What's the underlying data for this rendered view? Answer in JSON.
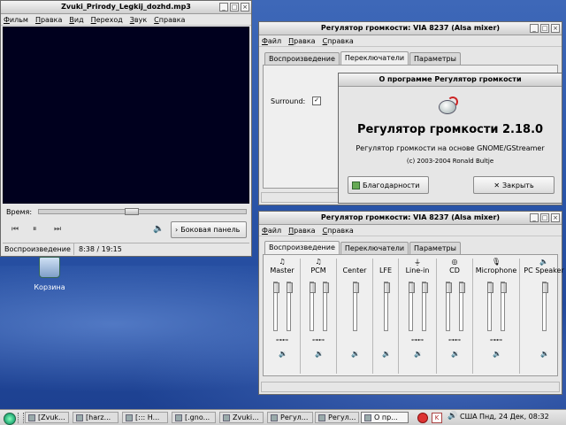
{
  "desktop": {
    "trash_label": "Корзина"
  },
  "player": {
    "title": "Zvuki_Prirody_Legkij_dozhd.mp3",
    "menu": [
      "Фильм",
      "Правка",
      "Вид",
      "Переход",
      "Звук",
      "Справка"
    ],
    "time_label": "Время:",
    "sidebar_button": "Боковая панель",
    "status_state": "Воспроизведение",
    "status_time": "8:38 / 19:15",
    "seek_progress": 0.44
  },
  "mixer_top": {
    "title": "Регулятор громкости: VIA 8237 (Alsa mixer)",
    "menu": [
      "Файл",
      "Правка",
      "Справка"
    ],
    "tabs": [
      "Воспроизведение",
      "Переключатели",
      "Параметры"
    ],
    "active_tab": 1,
    "surround_label": "Surround:",
    "surround_checked": true
  },
  "about": {
    "title": "О программе Регулятор громкости",
    "app_name": "Регулятор громкости 2.18.0",
    "description": "Регулятор громкости на основе GNOME/GStreamer",
    "copyright": "(c) 2003-2004 Ronald Bultje",
    "credits_button": "Благодарности",
    "close_button": "Закрыть"
  },
  "mixer_bottom": {
    "title": "Регулятор громкости: VIA 8237 (Alsa mixer)",
    "menu": [
      "Файл",
      "Правка",
      "Справка"
    ],
    "tabs": [
      "Воспроизведение",
      "Переключатели",
      "Параметры"
    ],
    "active_tab": 0,
    "channels": [
      {
        "name": "Master",
        "icon": "note-icon",
        "stereo": true,
        "levels": [
          0.0,
          0.0
        ]
      },
      {
        "name": "PCM",
        "icon": "note-icon",
        "stereo": true,
        "levels": [
          0.0,
          0.0
        ]
      },
      {
        "name": "Center",
        "icon": "",
        "stereo": false,
        "levels": [
          0.0
        ]
      },
      {
        "name": "LFE",
        "icon": "",
        "stereo": false,
        "levels": [
          0.0
        ]
      },
      {
        "name": "Line-in",
        "icon": "plug-icon",
        "stereo": true,
        "levels": [
          0.0,
          0.0
        ]
      },
      {
        "name": "CD",
        "icon": "cd-icon",
        "stereo": true,
        "levels": [
          0.0,
          0.0
        ]
      },
      {
        "name": "Microphone",
        "icon": "microphone-icon",
        "stereo": true,
        "levels": [
          0.0,
          0.0
        ]
      },
      {
        "name": "PC Speaker",
        "icon": "speaker-icon",
        "stereo": false,
        "levels": [
          0.0
        ]
      }
    ]
  },
  "taskbar": {
    "items": [
      "[Zvuk...",
      "[harz...",
      "[::: H...",
      "[.gno...",
      "Zvuki...",
      "Регул...",
      "Регул...",
      "О пр..."
    ],
    "active_index": 7,
    "keyboard_layout": "США",
    "clock": "Пнд, 24 Дек, 08:32"
  },
  "colors": {
    "video_bg": "#00001e",
    "desktop": "#2a55a9"
  }
}
